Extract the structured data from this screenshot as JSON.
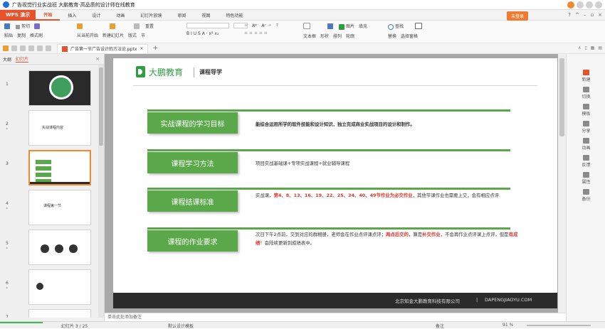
{
  "window": {
    "title": "广告视觉行业实战班 大鹏教育-高品质的设计师在线教育"
  },
  "ribbon": {
    "wps_label": "WPS 演示",
    "tabs": [
      "开始",
      "插入",
      "设计",
      "动画",
      "幻灯片放映",
      "审阅",
      "视图",
      "特色功能"
    ],
    "active_tab": "开始",
    "login_label": "未登录"
  },
  "toolbar": {
    "paste": "粘贴",
    "cut": "剪切",
    "copy": "复制",
    "format_painter": "格式刷",
    "from_current": "从当前开始",
    "new_slide": "新建幻灯片",
    "layout": "版式",
    "section": "节",
    "reset": "重置",
    "font_row": "B  I  U  S  A · x²  x₂",
    "text_box": "文本框",
    "shape": "形状",
    "picture": "图片",
    "fill": "填充",
    "arrange": "排列",
    "outline": "轮廓",
    "find": "查找",
    "replace": "替换",
    "select_pane": "选择窗格"
  },
  "quickbar": {
    "doc_tab": "广告第一节广告设计的方法论.pptx"
  },
  "left_panel": {
    "tabs": [
      "大纲",
      "幻灯片"
    ],
    "active_tab": "幻灯片",
    "thumb_numbers": [
      "1",
      "2",
      "3",
      "4",
      "5",
      "6",
      "7"
    ],
    "thumb_titles": [
      "",
      "实战课程内容",
      "",
      "课程第一节",
      "",
      "",
      ""
    ]
  },
  "slide": {
    "brand": "大鹏教育",
    "subtitle": "课程导学",
    "rows": [
      {
        "label": "实战课程的学习目标",
        "text": "能综合运用所学的软件技能和设计知识，独立完成商业实战项目的设计和制作。"
      },
      {
        "label": "课程学习方法",
        "text": "项目实战基础课+专项实战课程+就业辅导课程"
      },
      {
        "label": "课程结课标准",
        "text_a": "实战课，",
        "text_red": "第4、8、13、16、19、22、25、34、40、49节作业为必交作业",
        "text_b": "，其他节课作业也需要上交，会有相应点评"
      },
      {
        "label": "课程的作业要求",
        "text_a": "次日下午2点前，交到对应的群相册，老师会在作业点评课点评；",
        "red1": "两点后交的",
        "text_b": "，算是",
        "red2": "补交作业",
        "text_c": "，不会再作业点评课上点评，但是",
        "red3": "有成绩",
        "text_d": "！会陆续更新到成绩表中。"
      }
    ],
    "footer_company": "北京知金大鹏教育科技有限公司",
    "footer_sep": "|",
    "footer_url": "DAPENGJIAOYU.COM"
  },
  "right_panel": [
    "新建",
    "切换",
    "模板",
    "分享",
    "动画",
    "反馈",
    "属性",
    "备份"
  ],
  "notes": {
    "placeholder": "单击此处添加备注"
  },
  "statusbar": {
    "slide_info": "幻灯片 3 / 25",
    "theme": "默认设计模板",
    "notes_btn": "备注",
    "zoom": "91 %"
  },
  "colors": {
    "accent": "#e8512a",
    "green": "#5aa84a",
    "red": "#e0352b"
  }
}
